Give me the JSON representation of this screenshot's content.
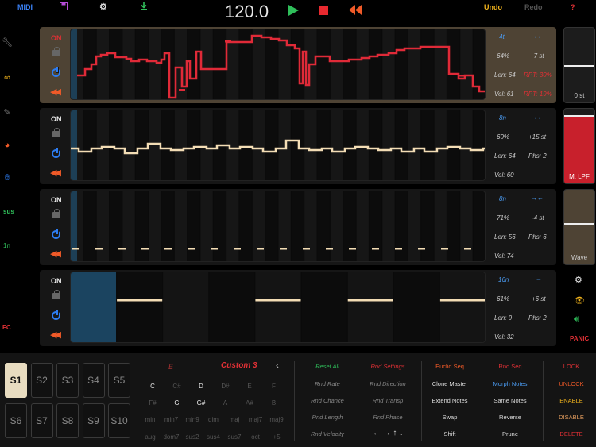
{
  "toolbar": {
    "midi": "MIDI",
    "tempo": "120.0",
    "undo": "Undo",
    "redo": "Redo",
    "help": "?"
  },
  "left": {
    "sus": "sus",
    "one_n": "1n",
    "fc": "FC"
  },
  "tracks": [
    {
      "on": "ON",
      "rate": "4t",
      "pct": "64%",
      "st": "+7 st",
      "len": "Len: 64",
      "rpt": "RPT: 30%",
      "vel": "Vel: 61",
      "rpt2": "RPT: 19%"
    },
    {
      "on": "ON",
      "rate": "8n",
      "pct": "60%",
      "st": "+15 st",
      "len": "Len: 64",
      "phs": "Phs: 2",
      "vel": "Vel: 60"
    },
    {
      "on": "ON",
      "rate": "8n",
      "pct": "71%",
      "st": "-4 st",
      "len": "Len: 56",
      "phs": "Phs: 6",
      "vel": "Vel: 74"
    },
    {
      "on": "ON",
      "rate": "16n",
      "pct": "61%",
      "st": "+6 st",
      "len": "Len: 9",
      "phs": "Phs: 2",
      "vel": "Vel: 32"
    }
  ],
  "side": {
    "pitch_label": "0 st",
    "filter_label": "M. LPF",
    "wave_label": "Wave",
    "panic": "PANIC",
    "filter_level": 0.92,
    "pitch_level": 0.5,
    "wave_level": 0.45
  },
  "slots": [
    "S1",
    "S2",
    "S3",
    "S4",
    "S5",
    "S6",
    "S7",
    "S8",
    "S9",
    "S10"
  ],
  "scale": {
    "name": "Custom 3",
    "notes": [
      "C",
      "C#",
      "D",
      "D#",
      "E",
      "F",
      "F#",
      "G",
      "G#",
      "A",
      "A#",
      "B"
    ],
    "chords_row1": [
      "min",
      "min7",
      "min9",
      "dim",
      "maj",
      "maj7",
      "maj9"
    ],
    "chords_row2": [
      "aug",
      "dom7",
      "sus2",
      "sus4",
      "sus7",
      "oct",
      "+5"
    ]
  },
  "random": {
    "reset_all": "Reset All",
    "rnd_settings": "Rnd Settings",
    "rnd_rate": "Rnd Rate",
    "rnd_direction": "Rnd Direction",
    "rnd_chance": "Rnd Chance",
    "rnd_transp": "Rnd Transp",
    "rnd_length": "Rnd Length",
    "rnd_phase": "Rnd Phase",
    "rnd_velocity": "Rnd Velocity",
    "arrows": "← → ↑ ↓"
  },
  "seqtools": {
    "euclid": "Euclid Seq",
    "rnd_seq": "Rnd Seq",
    "clone": "Clone Master",
    "morph": "Morph Notes",
    "extend": "Extend Notes",
    "same": "Same Notes",
    "swap": "Swap",
    "reverse": "Reverse",
    "shift": "Shift",
    "prune": "Prune"
  },
  "lockcol": {
    "lock": "LOCK",
    "unlock": "UNLOCK",
    "enable": "ENABLE",
    "disable": "DISABLE",
    "delete": "DELETE"
  },
  "colors": {
    "accent_red": "#e03035",
    "green": "#2fbe5a",
    "blue": "#2d7cf0",
    "note_cream": "#f3ddb5"
  }
}
